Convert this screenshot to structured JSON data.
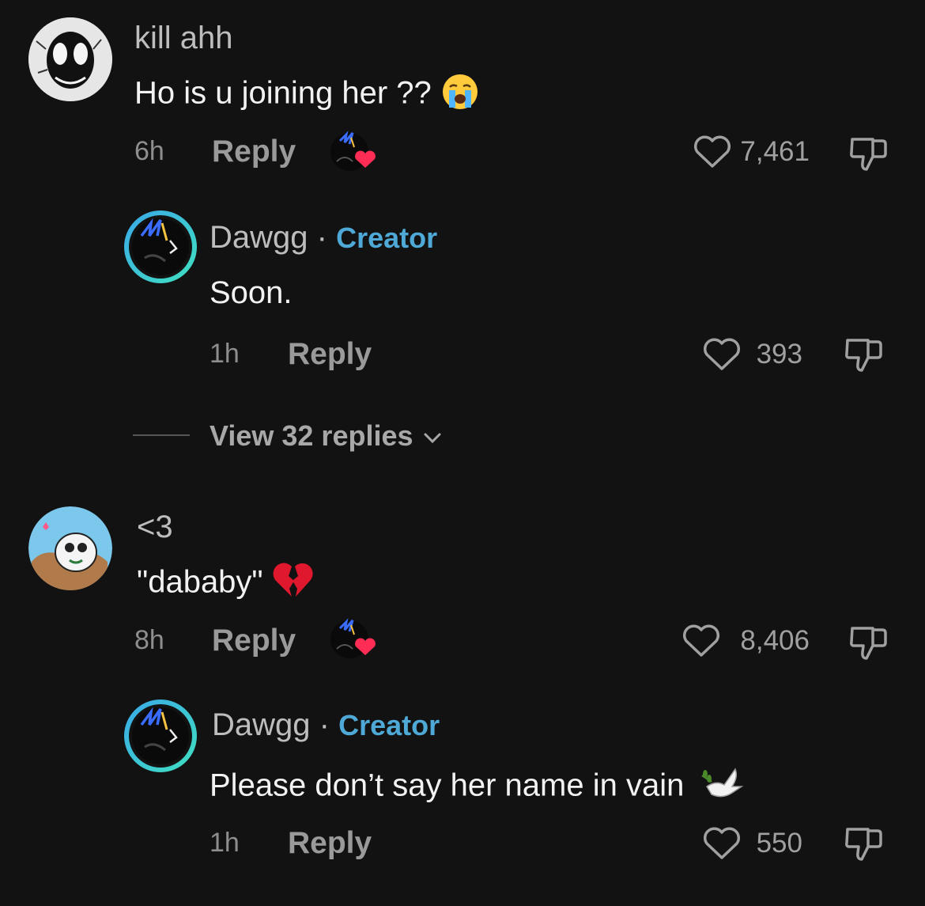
{
  "comments": [
    {
      "username": "kill ahh",
      "text": "Ho is u joining her ??",
      "emoji": "crying-face-emoji",
      "time": "6h",
      "reply_label": "Reply",
      "likes": "7,461",
      "reply": {
        "username": "Dawgg",
        "separator": "·",
        "badge": "Creator",
        "text": "Soon.",
        "time": "1h",
        "reply_label": "Reply",
        "likes": "393"
      },
      "view_replies": "View 32 replies"
    },
    {
      "username": "<3",
      "text": "\"dababy\"",
      "emoji": "broken-heart-emoji",
      "time": "8h",
      "reply_label": "Reply",
      "likes": "8,406",
      "reply": {
        "username": "Dawgg",
        "separator": "·",
        "badge": "Creator",
        "text": "Please don’t say her name in vain",
        "emoji": "dove-emoji",
        "time": "1h",
        "reply_label": "Reply",
        "likes": "550"
      }
    }
  ],
  "colors": {
    "background": "#121212",
    "creator_badge": "#4fa9d6",
    "liked_heart": "#ff2d55",
    "avatar_ring": "#40d0c8"
  }
}
